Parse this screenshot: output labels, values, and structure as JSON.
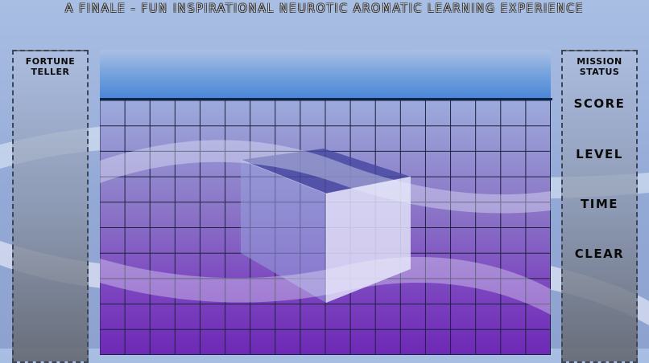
{
  "title": "A FINALE - FUN INSPIRATIONAL NEUROTIC AROMATIC LEARNING EXPERIENCE",
  "left_panel": {
    "heading_line1": "FORTUNE",
    "heading_line2": "TELLER"
  },
  "right_panel": {
    "heading_line1": "MISSION",
    "heading_line2": "STATUS",
    "score_label": "SCORE",
    "level_label": "LEVEL",
    "time_label": "TIME",
    "clear_label": "CLEAR"
  },
  "colors": {
    "background": "#a9bee3",
    "sky": "#4a86d6",
    "grid_top": "#9cabdb",
    "grid_bottom": "#6e28b6",
    "grid_line": "#1d2240",
    "cube_top": "#4d4fa3",
    "cube_front": "#dcdcf5"
  },
  "icons": [
    "cube-piece"
  ]
}
